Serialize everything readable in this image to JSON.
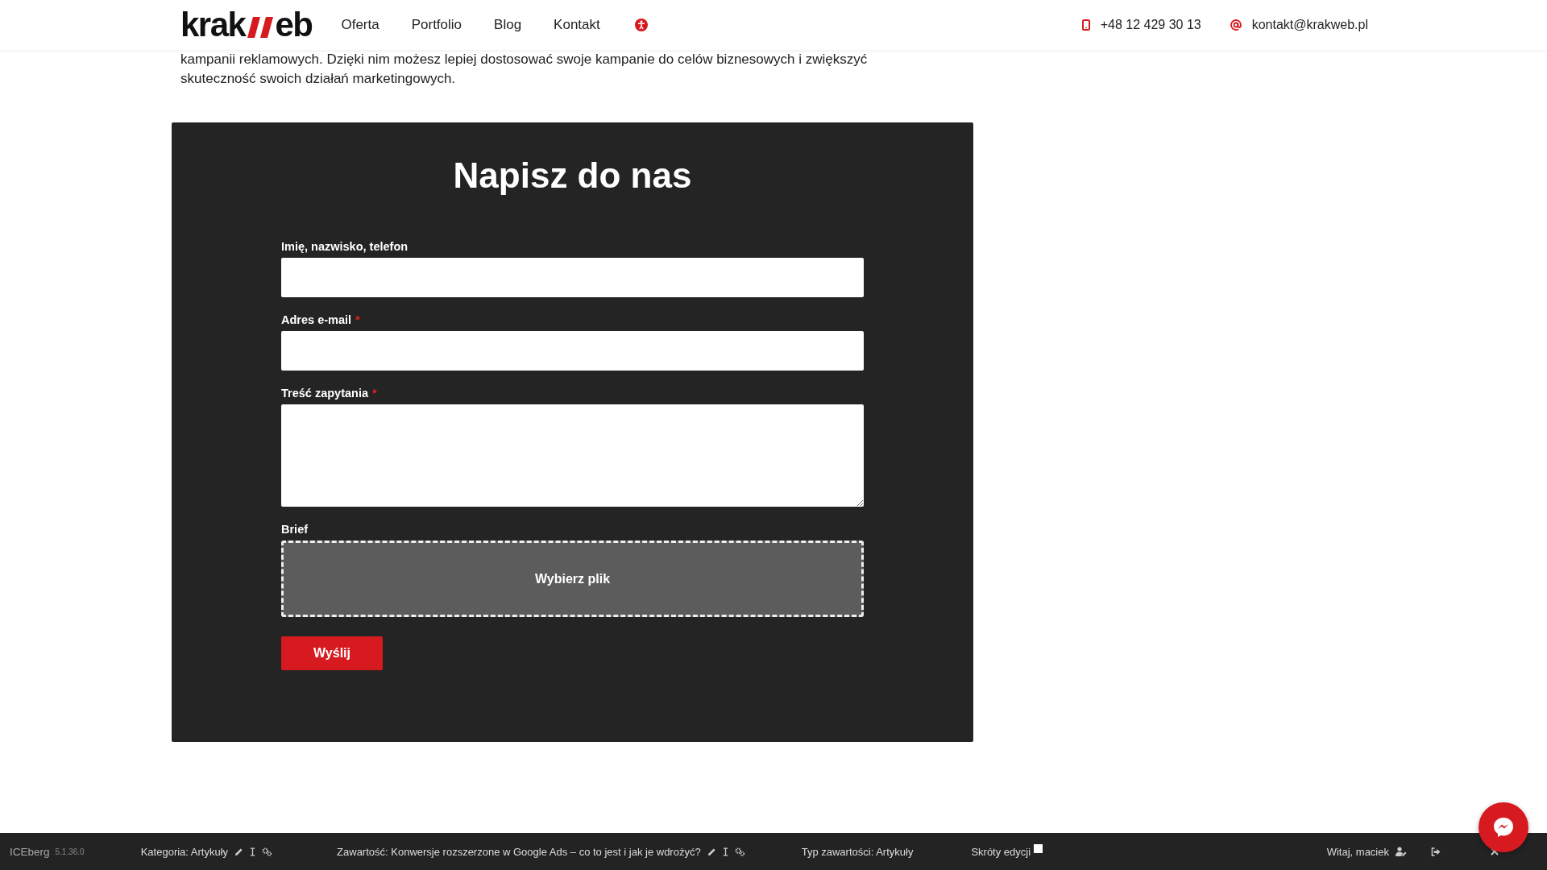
{
  "header": {
    "logo": {
      "left": "krak",
      "right": "eb"
    },
    "nav": [
      {
        "label": "Oferta"
      },
      {
        "label": "Portfolio"
      },
      {
        "label": "Blog"
      },
      {
        "label": "Kontakt"
      }
    ],
    "phone": "+48 12 429 30 13",
    "email": "kontakt@krakweb.pl"
  },
  "intro": "kampanii reklamowych. Dzięki nim możesz lepiej dostosować swoje kampanie do celów biznesowych i zwiększyć skuteczność swoich działań marketingowych.",
  "form": {
    "title": "Napisz do nas",
    "fields": [
      {
        "kind": "input",
        "label": "Imię, nazwisko, telefon"
      },
      {
        "kind": "input",
        "label": "Adres e-mail",
        "required_mark": "*"
      },
      {
        "kind": "textarea",
        "label": "Treść zapytania",
        "required_mark": "*"
      },
      {
        "kind": "file",
        "label": "Brief",
        "button": "Wybierz plik"
      }
    ],
    "submit": "Wyślij"
  },
  "admin_bar": {
    "brand": "ICEberg",
    "version": "5.1.36.0",
    "category": "Kategoria: Artykuły",
    "content": "Zawartość: Konwersje rozszerzone w Google Ads – co to jest i jak je wdrożyć?",
    "content_type": "Typ zawartości: Artykuły",
    "shortcuts": {
      "label": "Skróty edycji",
      "checked": false
    },
    "greeting": "Witaj, maciek"
  }
}
